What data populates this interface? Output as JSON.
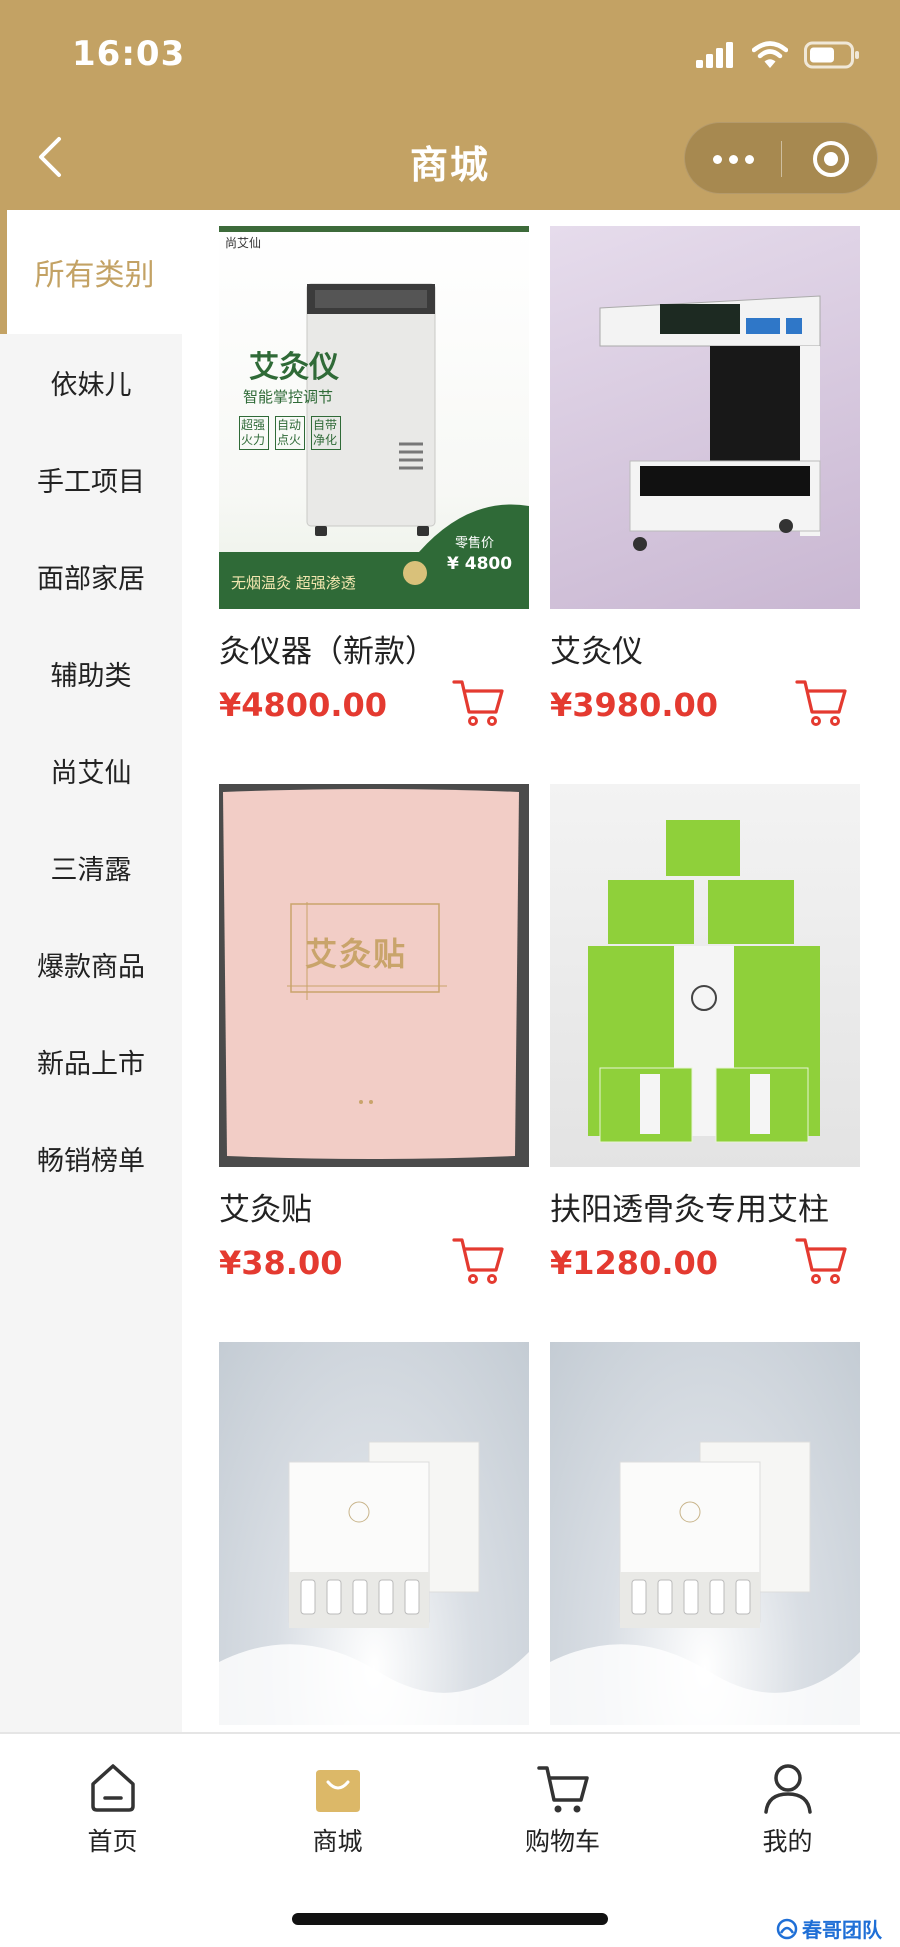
{
  "status_bar": {
    "time": "16:03"
  },
  "nav": {
    "title": "商城"
  },
  "sidebar": {
    "active": "所有类别",
    "items": [
      "依妹儿",
      "手工项目",
      "面部家居",
      "辅助类",
      "尚艾仙",
      "三清露",
      "爆款商品",
      "新品上市",
      "畅销榜单"
    ]
  },
  "products": [
    {
      "name": "灸仪器（新款）",
      "price": "¥4800.00",
      "image": {
        "brand": "尚艾仙",
        "headline": "艾灸仪",
        "subhead": "智能掌控调节",
        "features": [
          "超强\n火力",
          "自动\n点火",
          "自带\n净化"
        ],
        "retail_label": "零售价",
        "retail_price": "¥ 4800",
        "banner": "无烟温灸 超强渗透"
      }
    },
    {
      "name": "艾灸仪",
      "price": "¥3980.00"
    },
    {
      "name": "艾灸贴",
      "price": "¥38.00",
      "image": {
        "package_text": "艾灸贴"
      }
    },
    {
      "name": "扶阳透骨灸专用艾柱",
      "price": "¥1280.00"
    },
    {
      "name": "",
      "price": ""
    },
    {
      "name": "",
      "price": ""
    }
  ],
  "tabbar": [
    {
      "label": "首页",
      "icon": "home-icon"
    },
    {
      "label": "商城",
      "icon": "shopping-bag-icon",
      "active": true
    },
    {
      "label": "购物车",
      "icon": "cart-icon"
    },
    {
      "label": "我的",
      "icon": "user-icon"
    }
  ],
  "watermark": "春哥团队",
  "colors": {
    "brand_gold": "#c3a264",
    "price_red": "#e43a30",
    "sidebar_bg": "#f5f5f5"
  }
}
